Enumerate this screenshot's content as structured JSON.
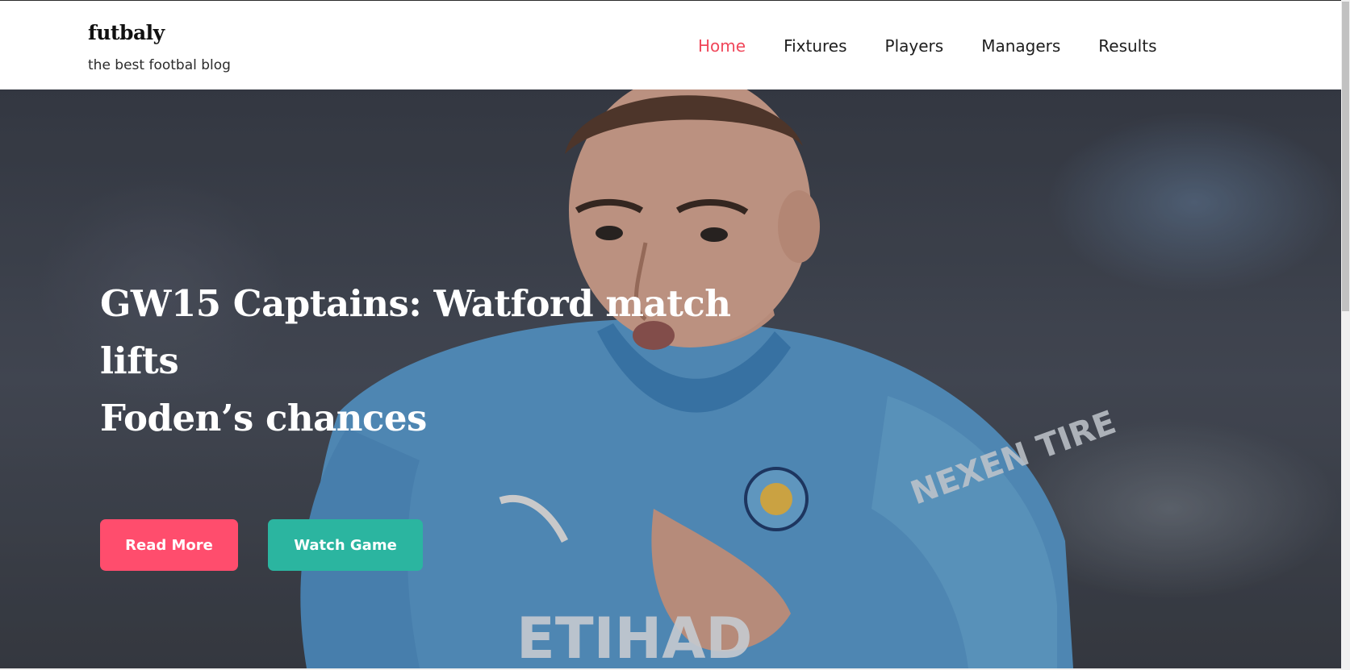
{
  "site": {
    "title": "futbaly",
    "tagline": "the best footbal blog"
  },
  "nav": {
    "items": [
      {
        "label": "Home",
        "active": true
      },
      {
        "label": "Fixtures",
        "active": false
      },
      {
        "label": "Players",
        "active": false
      },
      {
        "label": "Managers",
        "active": false
      },
      {
        "label": "Results",
        "active": false
      }
    ]
  },
  "hero": {
    "headline_line1": "GW15 Captains: Watford match lifts",
    "headline_line2": "Foden’s chances",
    "read_more_label": "Read More",
    "watch_game_label": "Watch Game",
    "image_icon": "footballer-photo",
    "shirt_sponsor_lettering": "ETIHAD",
    "sleeve_lettering": "NEXEN TIRE"
  },
  "colors": {
    "accent": "#f0475a",
    "read_more_button": "#ff4d6d",
    "watch_game_button": "#2bb5a0",
    "jersey": "#5ea4d8"
  }
}
